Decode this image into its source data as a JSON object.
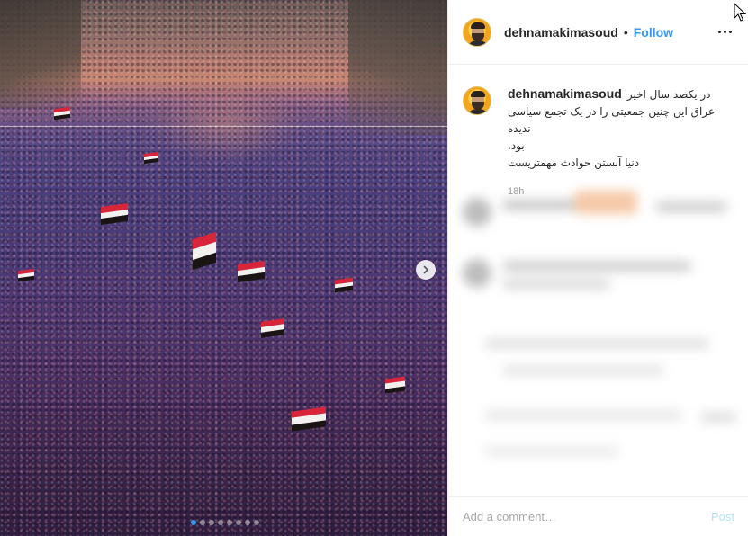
{
  "post": {
    "carousel": {
      "slide_count": 8,
      "active_index": 0,
      "next_icon": "chevron-right-icon"
    }
  },
  "header": {
    "username": "dehnamakimasoud",
    "separator": "•",
    "follow_label": "Follow",
    "more_icon": "more-horizontal-icon"
  },
  "caption": {
    "username": "dehnamakimasoud",
    "lines": [
      "در یکصد سال اخیر",
      "عراق این چنین جمعیتی را در یک تجمع سیاسی ندیده",
      "بود.",
      "دنیا آبستن حوادث مهمتریست"
    ],
    "time": "18h"
  },
  "footer": {
    "comment_placeholder": "Add a comment…",
    "post_label": "Post"
  },
  "colors": {
    "accent": "#3897f0",
    "post_disabled": "#b2dffc",
    "border": "#efefef",
    "muted": "#999999"
  }
}
